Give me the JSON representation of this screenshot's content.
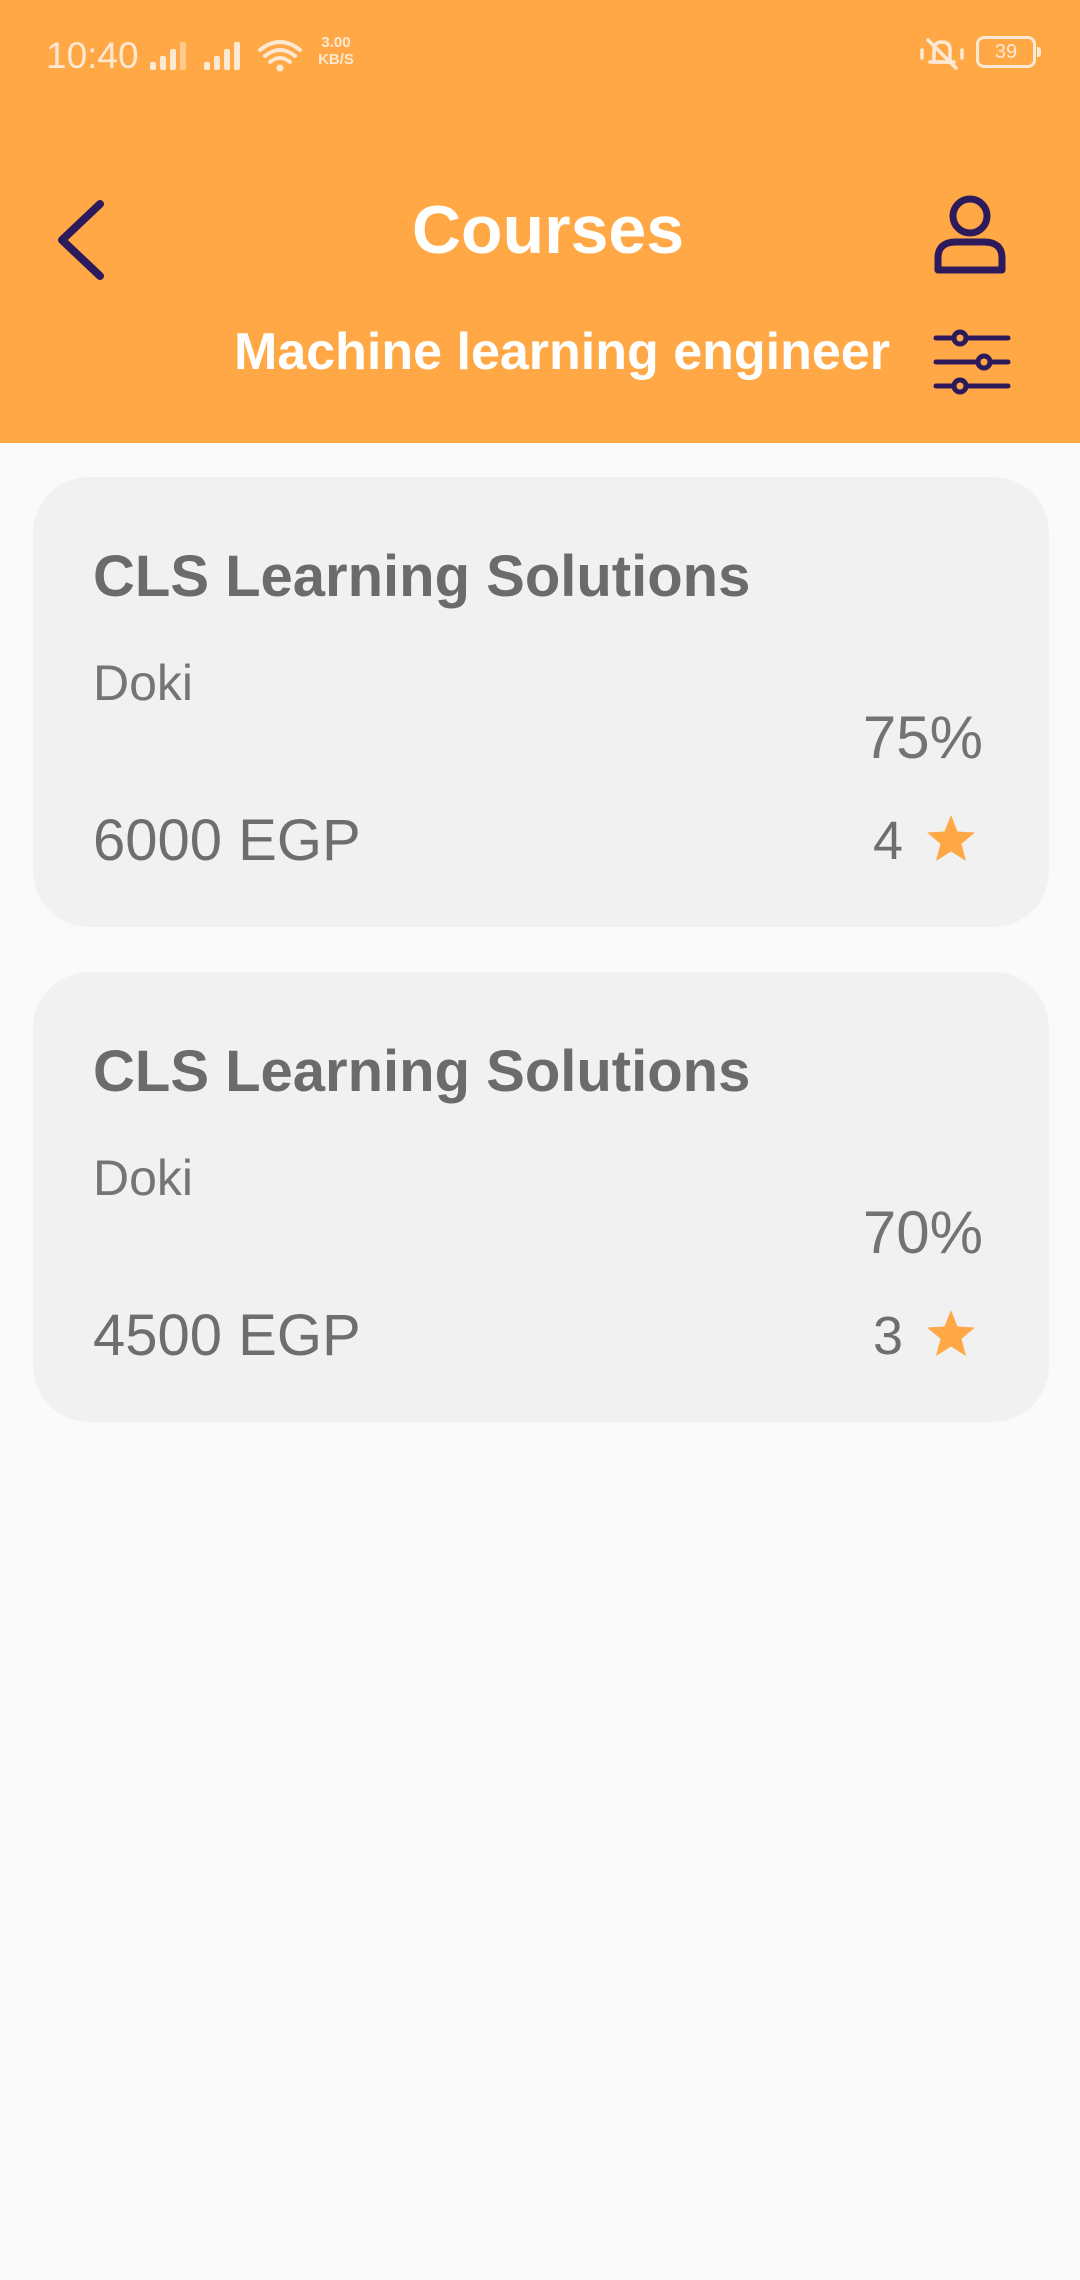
{
  "status_bar": {
    "time": "10:40",
    "net_speed_value": "3.00",
    "net_speed_unit": "KB/S",
    "battery": "39",
    "icons": [
      "signal-icon",
      "signal-icon",
      "wifi-icon",
      "mute-icon",
      "battery-icon"
    ]
  },
  "header": {
    "title": "Courses",
    "subtitle": "Machine learning engineer",
    "back_icon": "chevron-left-icon",
    "profile_icon": "user-icon",
    "filter_icon": "sliders-icon"
  },
  "colors": {
    "header_bg": "#ffa845",
    "icon_dark": "#2c1a5c",
    "card_bg": "#f1f1f1",
    "star": "#ffa845",
    "text_gray": "#6e6e6e"
  },
  "courses": [
    {
      "title": "CLS Learning Solutions",
      "provider": "Doki",
      "percent": "75%",
      "price": "6000 EGP",
      "rating": "4"
    },
    {
      "title": "CLS Learning Solutions",
      "provider": "Doki",
      "percent": "70%",
      "price": "4500 EGP",
      "rating": "3"
    }
  ]
}
